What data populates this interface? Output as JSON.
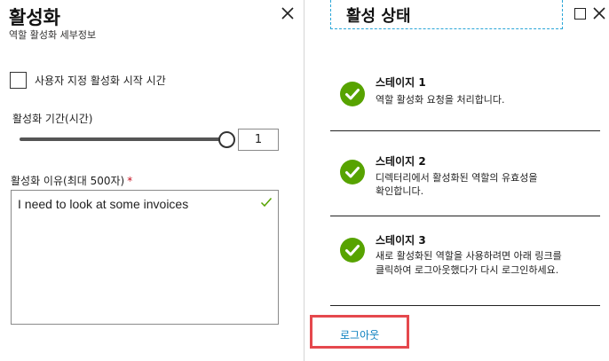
{
  "left_panel": {
    "title": "활성화",
    "subtitle": "역할 활성화 세부정보",
    "close_icon": "close-icon",
    "custom_start": {
      "label": "사용자 지정 활성화 시작 시간",
      "checked": false
    },
    "duration": {
      "label": "활성화 기간(시간)",
      "value": "1",
      "slider_fraction": 1.0
    },
    "reason": {
      "label": "활성화 이유(최대 500자)",
      "required_marker": "*",
      "value": "I need to look at some invoices",
      "valid_icon": "checkmark-icon"
    }
  },
  "right_panel": {
    "title": "활성 상태",
    "maximize_icon": "maximize-icon",
    "close_icon": "close-icon",
    "stages": [
      {
        "title": "스테이지 1",
        "lines": [
          "역할 활성화 요청을 처리합니다."
        ],
        "status_icon": "check-circle-icon"
      },
      {
        "title": "스테이지 2",
        "lines": [
          "디렉터리에서 활성화된 역할의 유효성을",
          "확인합니다."
        ],
        "status_icon": "check-circle-icon"
      },
      {
        "title": "스테이지 3",
        "lines": [
          "새로 활성화된 역할을 사용하려면 아래 링크를",
          "클릭하여 로그아웃했다가 다시 로그인하세요."
        ],
        "status_icon": "check-circle-icon"
      }
    ],
    "logout_link": "로그아웃"
  },
  "colors": {
    "success_green": "#57a300",
    "link_blue": "#0a7fbf",
    "highlight_red": "#e5484d",
    "required_red": "#c50f1f"
  }
}
